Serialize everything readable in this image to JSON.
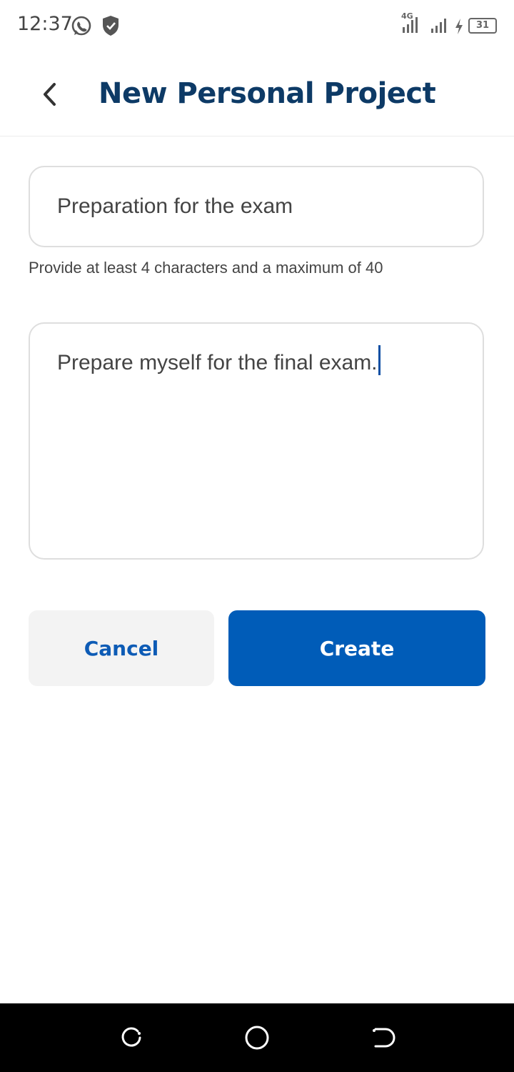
{
  "status_bar": {
    "time": "12:37",
    "network_label": "4G",
    "battery_level": "31",
    "icons": [
      "whatsapp-icon",
      "shield-icon",
      "signal-icon",
      "signal-icon",
      "charging-icon",
      "battery-icon"
    ]
  },
  "header": {
    "title": "New Personal Project",
    "back_icon": "chevron-left-icon"
  },
  "form": {
    "name_value": "Preparation for the exam",
    "name_hint": "Provide at least 4 characters and a maximum of 40",
    "description_value": "Prepare myself for the final exam."
  },
  "actions": {
    "cancel_label": "Cancel",
    "create_label": "Create"
  },
  "nav_bar": {
    "icons": [
      "recents-icon",
      "home-icon",
      "back-icon"
    ]
  },
  "colors": {
    "title": "#0d3a66",
    "primary": "#005cb8",
    "cancel_text": "#0d5bb5",
    "cancel_bg": "#f3f3f3",
    "border": "#dedede"
  }
}
